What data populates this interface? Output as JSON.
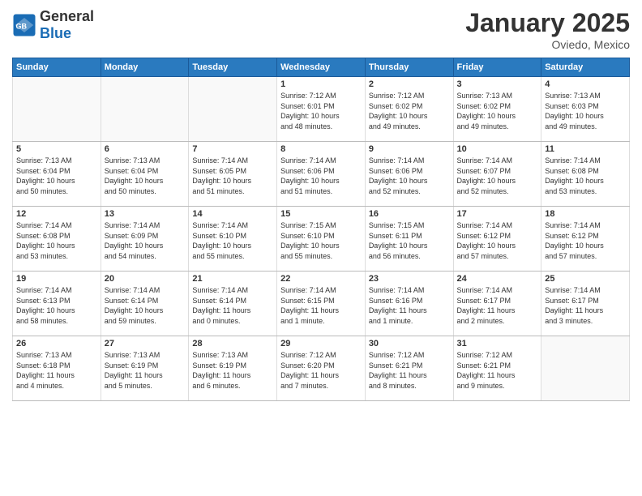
{
  "logo": {
    "general": "General",
    "blue": "Blue"
  },
  "header": {
    "month": "January 2025",
    "location": "Oviedo, Mexico"
  },
  "weekdays": [
    "Sunday",
    "Monday",
    "Tuesday",
    "Wednesday",
    "Thursday",
    "Friday",
    "Saturday"
  ],
  "weeks": [
    [
      {
        "day": "",
        "info": ""
      },
      {
        "day": "",
        "info": ""
      },
      {
        "day": "",
        "info": ""
      },
      {
        "day": "1",
        "info": "Sunrise: 7:12 AM\nSunset: 6:01 PM\nDaylight: 10 hours\nand 48 minutes."
      },
      {
        "day": "2",
        "info": "Sunrise: 7:12 AM\nSunset: 6:02 PM\nDaylight: 10 hours\nand 49 minutes."
      },
      {
        "day": "3",
        "info": "Sunrise: 7:13 AM\nSunset: 6:02 PM\nDaylight: 10 hours\nand 49 minutes."
      },
      {
        "day": "4",
        "info": "Sunrise: 7:13 AM\nSunset: 6:03 PM\nDaylight: 10 hours\nand 49 minutes."
      }
    ],
    [
      {
        "day": "5",
        "info": "Sunrise: 7:13 AM\nSunset: 6:04 PM\nDaylight: 10 hours\nand 50 minutes."
      },
      {
        "day": "6",
        "info": "Sunrise: 7:13 AM\nSunset: 6:04 PM\nDaylight: 10 hours\nand 50 minutes."
      },
      {
        "day": "7",
        "info": "Sunrise: 7:14 AM\nSunset: 6:05 PM\nDaylight: 10 hours\nand 51 minutes."
      },
      {
        "day": "8",
        "info": "Sunrise: 7:14 AM\nSunset: 6:06 PM\nDaylight: 10 hours\nand 51 minutes."
      },
      {
        "day": "9",
        "info": "Sunrise: 7:14 AM\nSunset: 6:06 PM\nDaylight: 10 hours\nand 52 minutes."
      },
      {
        "day": "10",
        "info": "Sunrise: 7:14 AM\nSunset: 6:07 PM\nDaylight: 10 hours\nand 52 minutes."
      },
      {
        "day": "11",
        "info": "Sunrise: 7:14 AM\nSunset: 6:08 PM\nDaylight: 10 hours\nand 53 minutes."
      }
    ],
    [
      {
        "day": "12",
        "info": "Sunrise: 7:14 AM\nSunset: 6:08 PM\nDaylight: 10 hours\nand 53 minutes."
      },
      {
        "day": "13",
        "info": "Sunrise: 7:14 AM\nSunset: 6:09 PM\nDaylight: 10 hours\nand 54 minutes."
      },
      {
        "day": "14",
        "info": "Sunrise: 7:14 AM\nSunset: 6:10 PM\nDaylight: 10 hours\nand 55 minutes."
      },
      {
        "day": "15",
        "info": "Sunrise: 7:15 AM\nSunset: 6:10 PM\nDaylight: 10 hours\nand 55 minutes."
      },
      {
        "day": "16",
        "info": "Sunrise: 7:15 AM\nSunset: 6:11 PM\nDaylight: 10 hours\nand 56 minutes."
      },
      {
        "day": "17",
        "info": "Sunrise: 7:14 AM\nSunset: 6:12 PM\nDaylight: 10 hours\nand 57 minutes."
      },
      {
        "day": "18",
        "info": "Sunrise: 7:14 AM\nSunset: 6:12 PM\nDaylight: 10 hours\nand 57 minutes."
      }
    ],
    [
      {
        "day": "19",
        "info": "Sunrise: 7:14 AM\nSunset: 6:13 PM\nDaylight: 10 hours\nand 58 minutes."
      },
      {
        "day": "20",
        "info": "Sunrise: 7:14 AM\nSunset: 6:14 PM\nDaylight: 10 hours\nand 59 minutes."
      },
      {
        "day": "21",
        "info": "Sunrise: 7:14 AM\nSunset: 6:14 PM\nDaylight: 11 hours\nand 0 minutes."
      },
      {
        "day": "22",
        "info": "Sunrise: 7:14 AM\nSunset: 6:15 PM\nDaylight: 11 hours\nand 1 minute."
      },
      {
        "day": "23",
        "info": "Sunrise: 7:14 AM\nSunset: 6:16 PM\nDaylight: 11 hours\nand 1 minute."
      },
      {
        "day": "24",
        "info": "Sunrise: 7:14 AM\nSunset: 6:17 PM\nDaylight: 11 hours\nand 2 minutes."
      },
      {
        "day": "25",
        "info": "Sunrise: 7:14 AM\nSunset: 6:17 PM\nDaylight: 11 hours\nand 3 minutes."
      }
    ],
    [
      {
        "day": "26",
        "info": "Sunrise: 7:13 AM\nSunset: 6:18 PM\nDaylight: 11 hours\nand 4 minutes."
      },
      {
        "day": "27",
        "info": "Sunrise: 7:13 AM\nSunset: 6:19 PM\nDaylight: 11 hours\nand 5 minutes."
      },
      {
        "day": "28",
        "info": "Sunrise: 7:13 AM\nSunset: 6:19 PM\nDaylight: 11 hours\nand 6 minutes."
      },
      {
        "day": "29",
        "info": "Sunrise: 7:12 AM\nSunset: 6:20 PM\nDaylight: 11 hours\nand 7 minutes."
      },
      {
        "day": "30",
        "info": "Sunrise: 7:12 AM\nSunset: 6:21 PM\nDaylight: 11 hours\nand 8 minutes."
      },
      {
        "day": "31",
        "info": "Sunrise: 7:12 AM\nSunset: 6:21 PM\nDaylight: 11 hours\nand 9 minutes."
      },
      {
        "day": "",
        "info": ""
      }
    ]
  ]
}
